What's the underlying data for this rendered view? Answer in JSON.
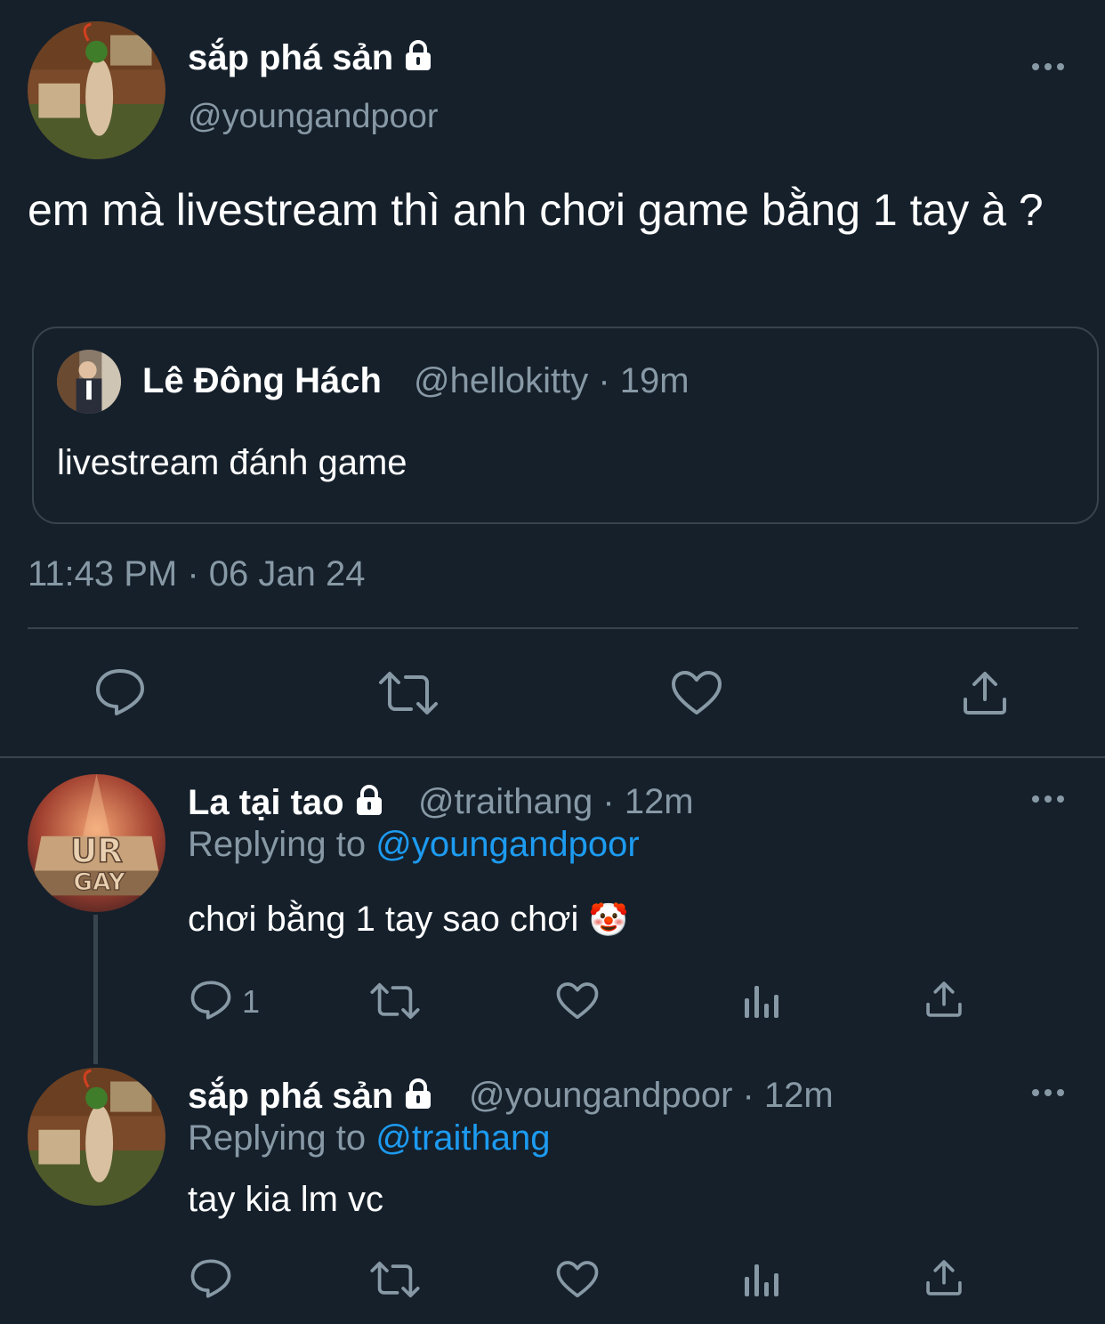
{
  "main_tweet": {
    "display_name": "sắp phá sản",
    "handle": "@youngandpoor",
    "text": "em mà livestream thì anh chơi game bằng 1 tay à ?",
    "timestamp": "11:43 PM · 06 Jan 24",
    "quote": {
      "display_name": "Lê Đông Hách",
      "handle_time": "@hellokitty · 19m",
      "text": "livestream đánh game"
    },
    "actions": [
      "reply-icon",
      "retweet-icon",
      "like-icon",
      "share-icon"
    ]
  },
  "replies": [
    {
      "display_name": "La tại tao",
      "handle_time": "@traithang · 12m",
      "replying_prefix": "Replying to",
      "replying_to": "@youngandpoor",
      "text": "chơi bằng 1 tay sao chơi",
      "emoji": "🤡",
      "reply_count": "1",
      "avatar_text_top": "UR",
      "avatar_text_bottom": "GAY"
    },
    {
      "display_name": "sắp phá sản",
      "handle_time": "@youngandpoor · 12m",
      "replying_prefix": "Replying to",
      "replying_to": "@traithang",
      "text": "tay kia lm vc",
      "reply_count": ""
    }
  ],
  "colors": {
    "background": "#15202b",
    "text": "#ffffff",
    "muted": "#8899a6",
    "link": "#1d9bf0",
    "border": "#38444d"
  }
}
